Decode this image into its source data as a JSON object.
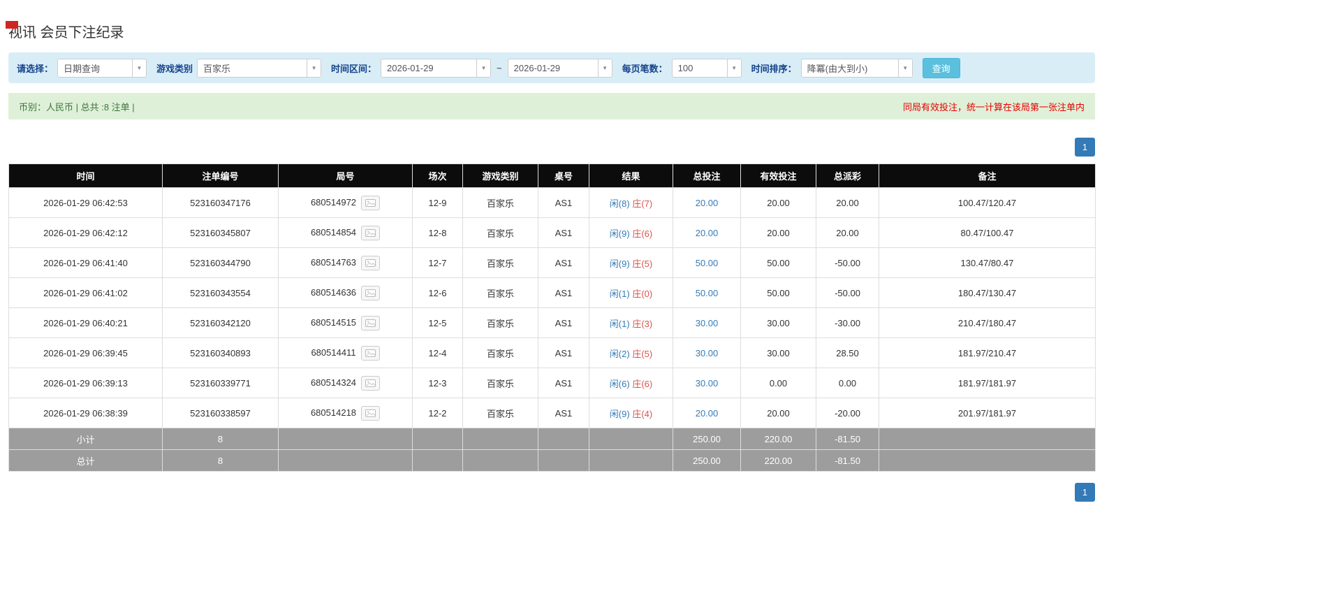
{
  "page": {
    "title": "视讯 会员下注纪录"
  },
  "icons": {
    "chevron_down": "▼"
  },
  "colors": {
    "filter_bar_bg": "#d9edf7",
    "filter_label_blue": "#15428b",
    "search_button_bg": "#5bc0de",
    "summary_bg": "#dff0d8",
    "summary_text_green": "#3c763d",
    "notice_red": "#e60000",
    "link_blue": "#337ab7",
    "player_blue": "#337ab7",
    "banker_red": "#d9534f",
    "negative_red": "#e60000",
    "table_header_bg": "#0c0c0c",
    "footer_row_bg": "#9d9d9d",
    "pagination_blue": "#337ab7",
    "top_marker_red": "#cf2525"
  },
  "filters": {
    "select_label": "请选择：",
    "select_value": "日期查询",
    "game_label": "游戏类别",
    "game_value": "百家乐",
    "range_label": "时间区间：",
    "date_from": "2026-01-29",
    "range_sep": "~",
    "date_to": "2026-01-29",
    "page_size_label": "每页笔数：",
    "page_size_value": "100",
    "sort_label": "时间排序：",
    "sort_value": "降冪(由大到小)",
    "search_button": "查询"
  },
  "summary": {
    "info": "币别：人民币 | 总共 :8 注单 |",
    "notice": "同局有效投注，统一计算在该局第一张注单内"
  },
  "pagination": {
    "page": "1"
  },
  "table": {
    "headers": [
      "时间",
      "注单编号",
      "局号",
      "场次",
      "游戏类别",
      "桌号",
      "结果",
      "总投注",
      "有效投注",
      "总派彩",
      "备注"
    ],
    "rows": [
      {
        "time": "2026-01-29 06:42:53",
        "bet_no": "523160347176",
        "round_no": "680514972",
        "session": "12-9",
        "game": "百家乐",
        "table_no": "AS1",
        "result_player": "闲(8)",
        "result_banker": "庄(7)",
        "total_bet": "20.00",
        "valid_bet": "20.00",
        "payout": "20.00",
        "remark": "100.47/120.47"
      },
      {
        "time": "2026-01-29 06:42:12",
        "bet_no": "523160345807",
        "round_no": "680514854",
        "session": "12-8",
        "game": "百家乐",
        "table_no": "AS1",
        "result_player": "闲(9)",
        "result_banker": "庄(6)",
        "total_bet": "20.00",
        "valid_bet": "20.00",
        "payout": "20.00",
        "remark": "80.47/100.47"
      },
      {
        "time": "2026-01-29 06:41:40",
        "bet_no": "523160344790",
        "round_no": "680514763",
        "session": "12-7",
        "game": "百家乐",
        "table_no": "AS1",
        "result_player": "闲(9)",
        "result_banker": "庄(5)",
        "total_bet": "50.00",
        "valid_bet": "50.00",
        "payout": "-50.00",
        "remark": "130.47/80.47"
      },
      {
        "time": "2026-01-29 06:41:02",
        "bet_no": "523160343554",
        "round_no": "680514636",
        "session": "12-6",
        "game": "百家乐",
        "table_no": "AS1",
        "result_player": "闲(1)",
        "result_banker": "庄(0)",
        "total_bet": "50.00",
        "valid_bet": "50.00",
        "payout": "-50.00",
        "remark": "180.47/130.47"
      },
      {
        "time": "2026-01-29 06:40:21",
        "bet_no": "523160342120",
        "round_no": "680514515",
        "session": "12-5",
        "game": "百家乐",
        "table_no": "AS1",
        "result_player": "闲(1)",
        "result_banker": "庄(3)",
        "total_bet": "30.00",
        "valid_bet": "30.00",
        "payout": "-30.00",
        "remark": "210.47/180.47"
      },
      {
        "time": "2026-01-29 06:39:45",
        "bet_no": "523160340893",
        "round_no": "680514411",
        "session": "12-4",
        "game": "百家乐",
        "table_no": "AS1",
        "result_player": "闲(2)",
        "result_banker": "庄(5)",
        "total_bet": "30.00",
        "valid_bet": "30.00",
        "payout": "28.50",
        "remark": "181.97/210.47"
      },
      {
        "time": "2026-01-29 06:39:13",
        "bet_no": "523160339771",
        "round_no": "680514324",
        "session": "12-3",
        "game": "百家乐",
        "table_no": "AS1",
        "result_player": "闲(6)",
        "result_banker": "庄(6)",
        "total_bet": "30.00",
        "valid_bet": "0.00",
        "payout": "0.00",
        "remark": "181.97/181.97"
      },
      {
        "time": "2026-01-29 06:38:39",
        "bet_no": "523160338597",
        "round_no": "680514218",
        "session": "12-2",
        "game": "百家乐",
        "table_no": "AS1",
        "result_player": "闲(9)",
        "result_banker": "庄(4)",
        "total_bet": "20.00",
        "valid_bet": "20.00",
        "payout": "-20.00",
        "remark": "201.97/181.97"
      }
    ],
    "subtotal": {
      "label": "小计",
      "count": "8",
      "total_bet": "250.00",
      "valid_bet": "220.00",
      "payout": "-81.50"
    },
    "grand_total": {
      "label": "总计",
      "count": "8",
      "total_bet": "250.00",
      "valid_bet": "220.00",
      "payout": "-81.50"
    }
  }
}
